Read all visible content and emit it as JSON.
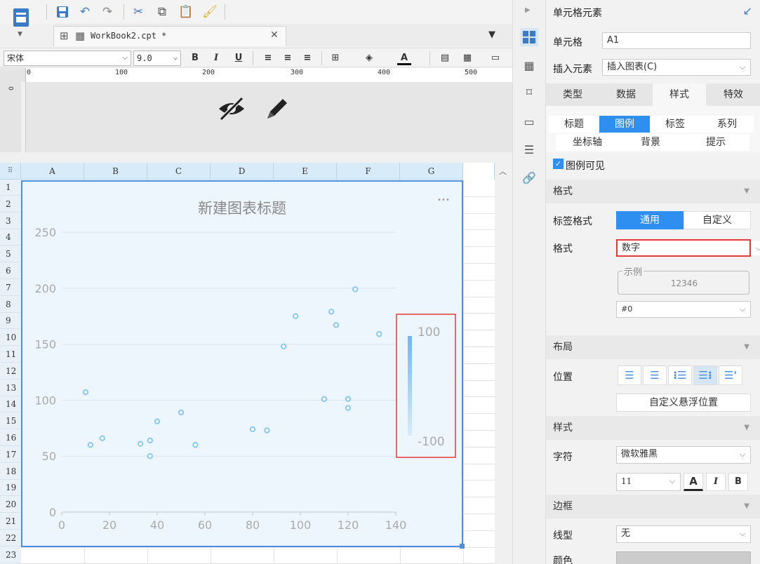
{
  "toolbar": {
    "tab_title": "WorkBook2.cpt *"
  },
  "format": {
    "font": "宋体",
    "size": "9.0",
    "bold": "B",
    "italic": "I",
    "underline": "U",
    "font_color_letter": "A"
  },
  "ruler": {
    "ticks": [
      "0",
      "100",
      "200",
      "300",
      "400",
      "500"
    ],
    "vtick": "0"
  },
  "grid": {
    "columns": [
      "A",
      "B",
      "C",
      "D",
      "E",
      "F",
      "G"
    ],
    "rows": [
      "1",
      "2",
      "3",
      "4",
      "5",
      "6",
      "7",
      "8",
      "9",
      "10",
      "11",
      "12",
      "13",
      "14",
      "15",
      "16",
      "17",
      "18",
      "19",
      "20",
      "21",
      "22",
      "23"
    ]
  },
  "chart_data": {
    "type": "scatter",
    "title": "新建图表标题",
    "more": "•••",
    "xlim": [
      0,
      140
    ],
    "ylim": [
      0,
      250
    ],
    "x_ticks": [
      "0",
      "20",
      "40",
      "60",
      "80",
      "100",
      "120",
      "140"
    ],
    "y_ticks": [
      "0",
      "50",
      "100",
      "150",
      "200",
      "250"
    ],
    "points": [
      {
        "x": 10,
        "y": 107
      },
      {
        "x": 12,
        "y": 60
      },
      {
        "x": 17,
        "y": 66
      },
      {
        "x": 33,
        "y": 61
      },
      {
        "x": 37,
        "y": 64
      },
      {
        "x": 37,
        "y": 50
      },
      {
        "x": 40,
        "y": 81
      },
      {
        "x": 50,
        "y": 89
      },
      {
        "x": 56,
        "y": 60
      },
      {
        "x": 80,
        "y": 74
      },
      {
        "x": 86,
        "y": 73
      },
      {
        "x": 93,
        "y": 148
      },
      {
        "x": 98,
        "y": 175
      },
      {
        "x": 110,
        "y": 101
      },
      {
        "x": 113,
        "y": 179
      },
      {
        "x": 115,
        "y": 167
      },
      {
        "x": 120,
        "y": 101
      },
      {
        "x": 120,
        "y": 93
      },
      {
        "x": 123,
        "y": 199
      },
      {
        "x": 133,
        "y": 159
      }
    ],
    "legend": {
      "type": "gradient",
      "max": "100",
      "min": "-100",
      "position": "right"
    },
    "colors": {
      "point": "#87c8f2",
      "selection": "#4a90e2",
      "highlight": "#e53935"
    }
  },
  "panel": {
    "title": "单元格元素",
    "cell_label": "单元格",
    "cell_value": "A1",
    "insert_label": "插入元素",
    "insert_value": "插入图表(C)",
    "tabs": [
      "类型",
      "数据",
      "样式",
      "特效"
    ],
    "active_tab": "样式",
    "subtabs_row1": [
      "标题",
      "图例",
      "标签",
      "系列"
    ],
    "subtabs_row2": [
      "坐标轴",
      "背景",
      "提示"
    ],
    "active_subtab": "图例",
    "legend_visible": "图例可见",
    "sec_format": "格式",
    "label_format_label": "标签格式",
    "label_format_opts": [
      "通用",
      "自定义"
    ],
    "format_label": "格式",
    "format_value": "数字",
    "example_label": "示例",
    "example_value": "12346",
    "pattern_value": "#0",
    "sec_layout": "布局",
    "position_label": "位置",
    "custom_float": "自定义悬浮位置",
    "sec_style": "样式",
    "char_label": "字符",
    "font_value": "微软雅黑",
    "font_size": "11",
    "sec_border": "边框",
    "line_label": "线型",
    "line_value": "无",
    "color_label": "颜色"
  }
}
